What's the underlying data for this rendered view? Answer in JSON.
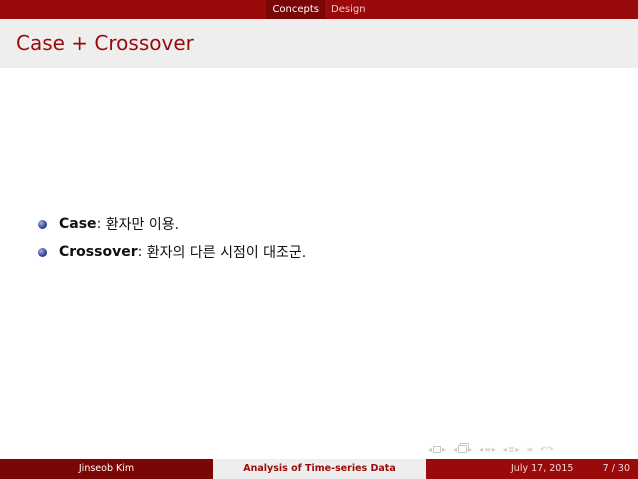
{
  "header": {
    "sections": [
      "Concepts",
      "Design"
    ],
    "active_section": "Concepts"
  },
  "frame": {
    "title": "Case + Crossover"
  },
  "content": {
    "items": [
      {
        "term": "Case",
        "sep": ":",
        "text": " 환자만 이용."
      },
      {
        "term": "Crossover",
        "sep": ":",
        "text": " 환자의 다른 시점이 대조군."
      }
    ]
  },
  "nav_icons": [
    "arrow-left-icon",
    "frame-icon",
    "arrow-right-icon",
    "subsection-icon",
    "section-icon",
    "zoom-icon",
    "undo-icon"
  ],
  "footer": {
    "author": "Jinseob Kim",
    "title": "Analysis of Time-series Data",
    "date": "July 17, 2015",
    "page": "7 / 30"
  },
  "colors": {
    "brand": "#9b0a0a",
    "brand_dark": "#7a0606",
    "title_bg": "#eeeeee"
  }
}
